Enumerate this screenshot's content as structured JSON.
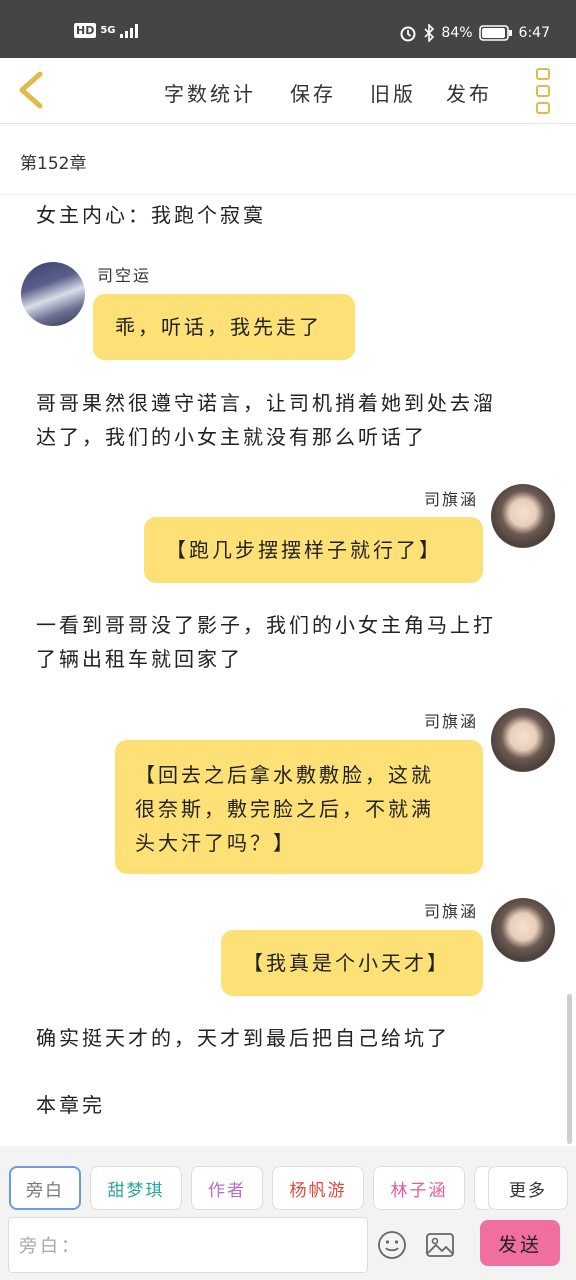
{
  "status": {
    "network_badge": "HD",
    "network_type": "5G",
    "battery": "84%",
    "time": "6:47"
  },
  "toolbar": {
    "word_count": "字数统计",
    "save": "保存",
    "old_version": "旧版",
    "publish": "发布"
  },
  "chapter": {
    "title": "第152章"
  },
  "story": {
    "narration_1": "女主内心：我跑个寂寞",
    "msg1_name": "司空运",
    "msg1_text": "乖，听话，我先走了",
    "narration_2_line1": "哥哥果然很遵守诺言，让司机捎着她到处去溜",
    "narration_2_line2": "达了，我们的小女主就没有那么听话了",
    "msg2_name": "司旗涵",
    "msg2_text": "【跑几步摆摆样子就行了】",
    "narration_3_line1": "一看到哥哥没了影子，我们的小女主角马上打",
    "narration_3_line2": "了辆出租车就回家了",
    "msg3_name": "司旗涵",
    "msg3_line1": "【回去之后拿水敷敷脸，这就",
    "msg3_line2": "很奈斯，敷完脸之后，不就满",
    "msg3_line3": "头大汗了吗？】",
    "msg4_name": "司旗涵",
    "msg4_text": "【我真是个小天才】",
    "narration_4": "确实挺天才的，天才到最后把自己给坑了",
    "narration_5": "本章完"
  },
  "roles": {
    "narrator": "旁白",
    "role1": "甜梦琪",
    "author": "作者",
    "role2": "杨帆游",
    "role3": "林子涵",
    "more": "更多",
    "colors": {
      "narrator": "#777777",
      "role1": "#2aa6a0",
      "author": "#b66ec8",
      "role2": "#e0463c",
      "role3": "#e05aa0",
      "more": "#333333"
    }
  },
  "input": {
    "placeholder": "旁白：",
    "send": "发送"
  }
}
